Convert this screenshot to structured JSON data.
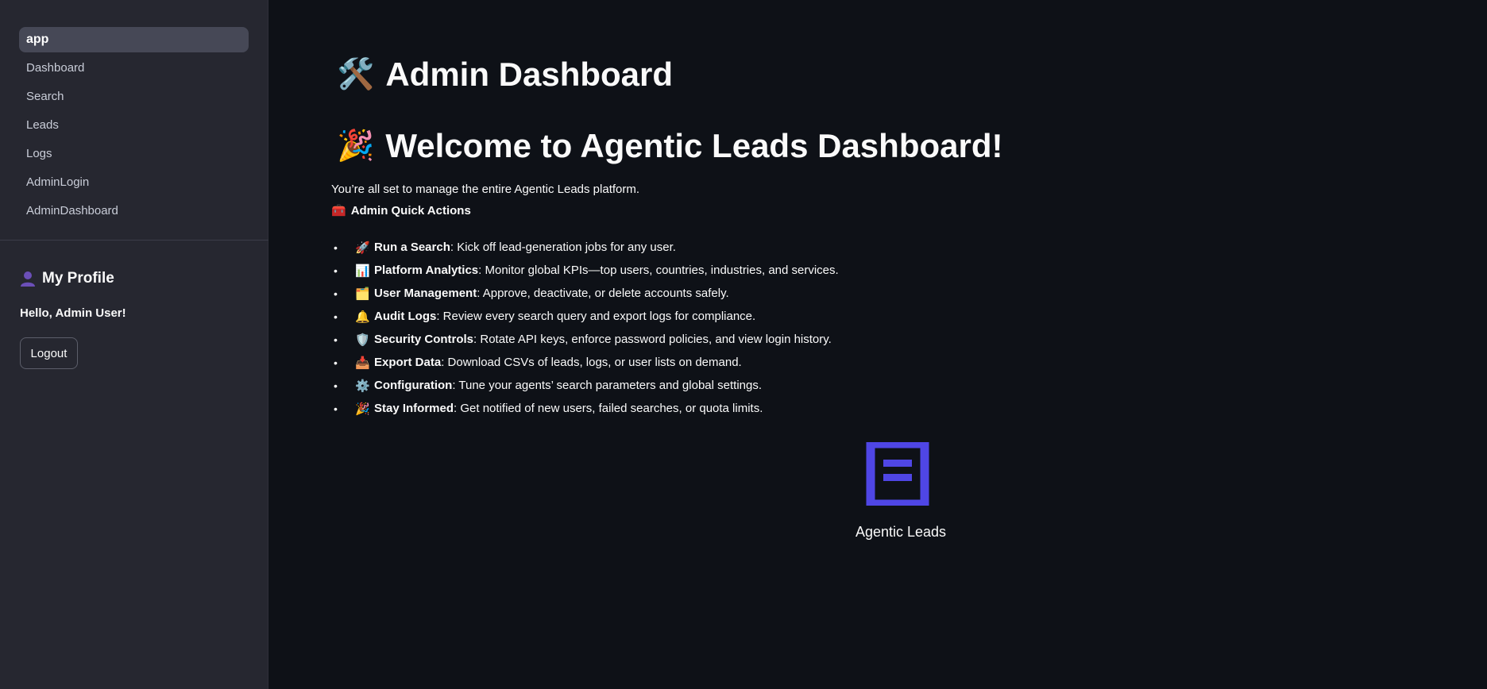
{
  "sidebar": {
    "nav": [
      {
        "label": "app",
        "active": true
      },
      {
        "label": "Dashboard"
      },
      {
        "label": "Search"
      },
      {
        "label": "Leads"
      },
      {
        "label": "Logs"
      },
      {
        "label": "AdminLogin"
      },
      {
        "label": "AdminDashboard"
      }
    ],
    "profile_title": "My Profile",
    "hello": "Hello, Admin User!",
    "logout_label": "Logout"
  },
  "main": {
    "title": "Admin Dashboard",
    "title_icon": "🛠️",
    "welcome": "Welcome to Agentic Leads Dashboard!",
    "welcome_icon": "🎉",
    "intro": "You’re all set to manage the entire Agentic Leads platform.",
    "quick_actions_label": "Admin Quick Actions",
    "quick_actions_icon": "🧰",
    "actions": [
      {
        "icon": "🚀",
        "title": "Run a Search",
        "desc": ": Kick off lead-generation jobs for any user."
      },
      {
        "icon": "📊",
        "title": "Platform Analytics",
        "desc": ": Monitor global KPIs—top users, countries, industries, and services."
      },
      {
        "icon": "🗂️",
        "title": "User Management",
        "desc": ": Approve, deactivate, or delete accounts safely."
      },
      {
        "icon": "🔔",
        "title": "Audit Logs",
        "desc": ": Review every search query and export logs for compliance."
      },
      {
        "icon": "🛡️",
        "title": "Security Controls",
        "desc": ": Rotate API keys, enforce password policies, and view login history."
      },
      {
        "icon": "📥",
        "title": "Export Data",
        "desc": ": Download CSVs of leads, logs, or user lists on demand."
      },
      {
        "icon": "⚙️",
        "title": "Configuration",
        "desc": ": Tune your agents’ search parameters and global settings."
      },
      {
        "icon": "🎉",
        "title": "Stay Informed",
        "desc": ": Get notified of new users, failed searches, or quota limits."
      }
    ],
    "logo_caption": "Agentic Leads",
    "logo_color": "#4f46e5"
  }
}
